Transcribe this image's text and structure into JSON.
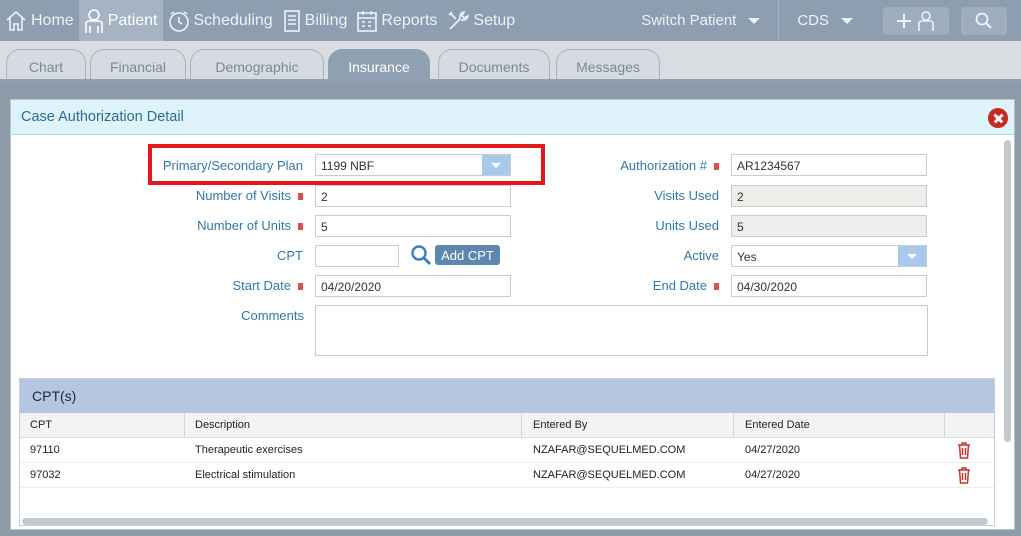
{
  "nav": {
    "items": [
      {
        "label": "Home",
        "icon": "home-icon"
      },
      {
        "label": "Patient",
        "icon": "patient-icon"
      },
      {
        "label": "Scheduling",
        "icon": "clock-icon"
      },
      {
        "label": "Billing",
        "icon": "billing-icon"
      },
      {
        "label": "Reports",
        "icon": "calendar-icon"
      },
      {
        "label": "Setup",
        "icon": "tools-icon"
      }
    ],
    "switch_patient": "Switch Patient",
    "cds": "CDS"
  },
  "tabs": [
    {
      "label": "Chart"
    },
    {
      "label": "Financial"
    },
    {
      "label": "Demographic"
    },
    {
      "label": "Insurance"
    },
    {
      "label": "Documents"
    },
    {
      "label": "Messages"
    }
  ],
  "modal": {
    "title": "Case Authorization Detail",
    "form": {
      "plan_label": "Primary/Secondary Plan",
      "plan_value": "1199 NBF",
      "visits_label": "Number of Visits",
      "visits_value": "2",
      "units_label": "Number of Units",
      "units_value": "5",
      "cpt_label": "CPT",
      "cpt_value": "",
      "add_cpt": "Add CPT",
      "start_label": "Start Date",
      "start_value": "04/20/2020",
      "comments_label": "Comments",
      "comments_value": "",
      "auth_label": "Authorization #",
      "auth_value": "AR1234567",
      "visits_used_label": "Visits Used",
      "visits_used_value": "2",
      "units_used_label": "Units Used",
      "units_used_value": "5",
      "active_label": "Active",
      "active_value": "Yes",
      "end_label": "End Date",
      "end_value": "04/30/2020"
    },
    "cpt_grid": {
      "title": "CPT(s)",
      "columns": [
        "CPT",
        "Description",
        "Entered By",
        "Entered Date"
      ],
      "rows": [
        {
          "cpt": "97110",
          "description": "Therapeutic exercises",
          "entered_by": "NZAFAR@SEQUELMED.COM",
          "entered_date": "04/27/2020"
        },
        {
          "cpt": "97032",
          "description": "Electrical stimulation",
          "entered_by": "NZAFAR@SEQUELMED.COM",
          "entered_date": "04/27/2020"
        }
      ]
    }
  },
  "colors": {
    "accent": "#2f78ae",
    "highlight": "#e4171a",
    "required": "#e24b4b"
  }
}
